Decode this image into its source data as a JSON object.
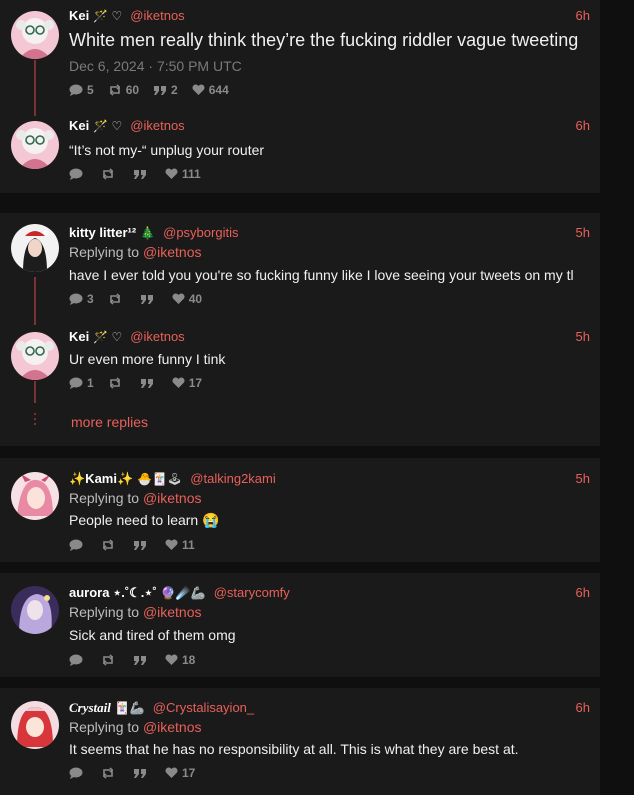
{
  "posts": [
    {
      "name": "Kei",
      "deco": "🪄 ♡",
      "handle": "@iketnos",
      "time": "6h",
      "text": "White men really think they’re the fucking riddler vague tweeting",
      "date": "Dec 6, 2024 · 7:50 PM UTC",
      "replies": "5",
      "retweets": "60",
      "quotes": "2",
      "likes": "644"
    },
    {
      "name": "Kei",
      "deco": "🪄 ♡",
      "handle": "@iketnos",
      "time": "6h",
      "text": "“It’s not my-“ unplug your router",
      "replies": "",
      "retweets": "",
      "quotes": "",
      "likes": "111"
    },
    {
      "name": "kitty litter¹²",
      "deco": "🎄",
      "handle": "@psyborgitis",
      "time": "5h",
      "reply_label": "Replying to",
      "reply_handle": "@iketnos",
      "text": "have I ever told you you're so fucking funny like I love seeing your tweets on my tl",
      "replies": "3",
      "retweets": "",
      "quotes": "",
      "likes": "40"
    },
    {
      "name": "Kei",
      "deco": "🪄 ♡",
      "handle": "@iketnos",
      "time": "5h",
      "text": "Ur even more funny I tink",
      "replies": "1",
      "retweets": "",
      "quotes": "",
      "likes": "17"
    },
    {
      "name": "✨Kami✨",
      "deco": "🐣🃏🕹",
      "handle": "@talking2kami",
      "time": "5h",
      "reply_label": "Replying to",
      "reply_handle": "@iketnos",
      "text": "People need to learn 😭",
      "replies": "",
      "retweets": "",
      "quotes": "",
      "likes": "11"
    },
    {
      "name": "aurora ⋆.˚☾.⋆˚",
      "deco": "🔮☄️🦾",
      "handle": "@starycomfy",
      "time": "6h",
      "reply_label": "Replying to",
      "reply_handle": "@iketnos",
      "text": "Sick and tired of them omg",
      "replies": "",
      "retweets": "",
      "quotes": "",
      "likes": "18"
    },
    {
      "name": "Crystail",
      "deco": "🃏🦾",
      "handle": "@Crystalisayion_",
      "time": "6h",
      "reply_label": "Replying to",
      "reply_handle": "@iketnos",
      "text": "It seems that he has no responsibility at all. This is what they are best at.",
      "replies": "",
      "retweets": "",
      "quotes": "",
      "likes": "17"
    }
  ],
  "more_replies": "more replies",
  "colors": {
    "accent": "#e8605a",
    "card": "#1a1a1a",
    "background": "#0f0f0f"
  }
}
